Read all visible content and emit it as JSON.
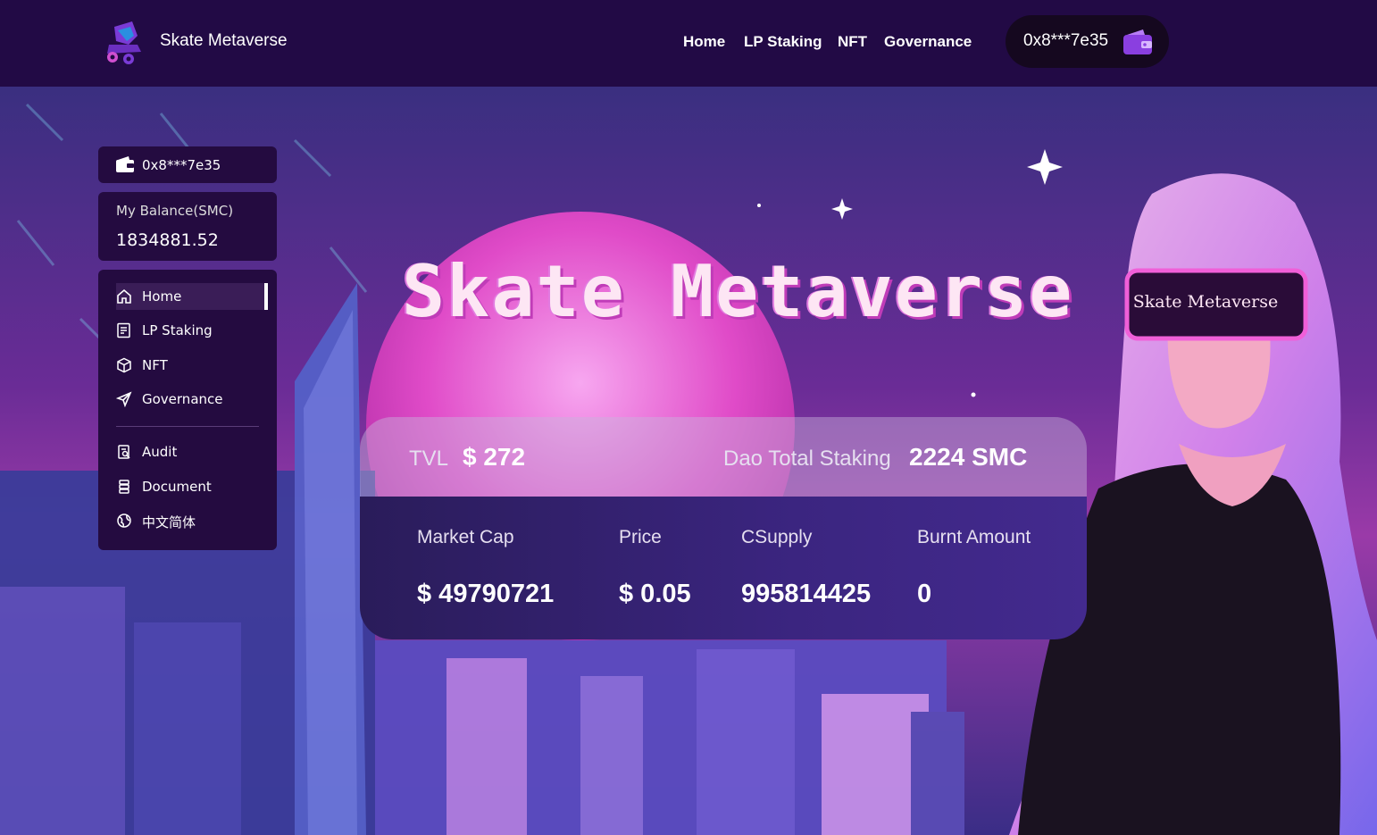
{
  "header": {
    "brand": "Skate Metaverse",
    "nav": [
      "Home",
      "LP Staking",
      "NFT",
      "Governance"
    ],
    "wallet_address": "0x8***7e35",
    "logo_icon": "skate-logo-icon",
    "wallet_icon": "wallet-icon"
  },
  "sidebar": {
    "wallet_address": "0x8***7e35",
    "balance_label": "My Balance(SMC)",
    "balance_value": "1834881.52",
    "menu": [
      {
        "label": "Home",
        "icon": "home-icon",
        "active": true
      },
      {
        "label": "LP Staking",
        "icon": "document-list-icon"
      },
      {
        "label": "NFT",
        "icon": "cube-icon"
      },
      {
        "label": "Governance",
        "icon": "send-icon"
      }
    ],
    "links": [
      {
        "label": "Audit",
        "icon": "audit-icon"
      },
      {
        "label": "Document",
        "icon": "stack-icon"
      },
      {
        "label": "中文简体",
        "icon": "globe-icon"
      }
    ]
  },
  "hero": {
    "title": "Skate Metaverse",
    "visor_text": "Skate Metaverse"
  },
  "stats": {
    "tvl_label": "TVL",
    "tvl_value": "$ 272",
    "dao_label": "Dao Total Staking",
    "dao_value": "2224 SMC",
    "items": [
      {
        "label": "Market Cap",
        "value": "$ 49790721"
      },
      {
        "label": "Price",
        "value": "$ 0.05"
      },
      {
        "label": "CSupply",
        "value": "995814425"
      },
      {
        "label": "Burnt Amount",
        "value": "0"
      }
    ]
  },
  "colors": {
    "header_bg": "#220a45",
    "sidebar_bg": "#240b40",
    "accent_purple": "#8a3fe0",
    "title_pink": "#fde6f4"
  }
}
